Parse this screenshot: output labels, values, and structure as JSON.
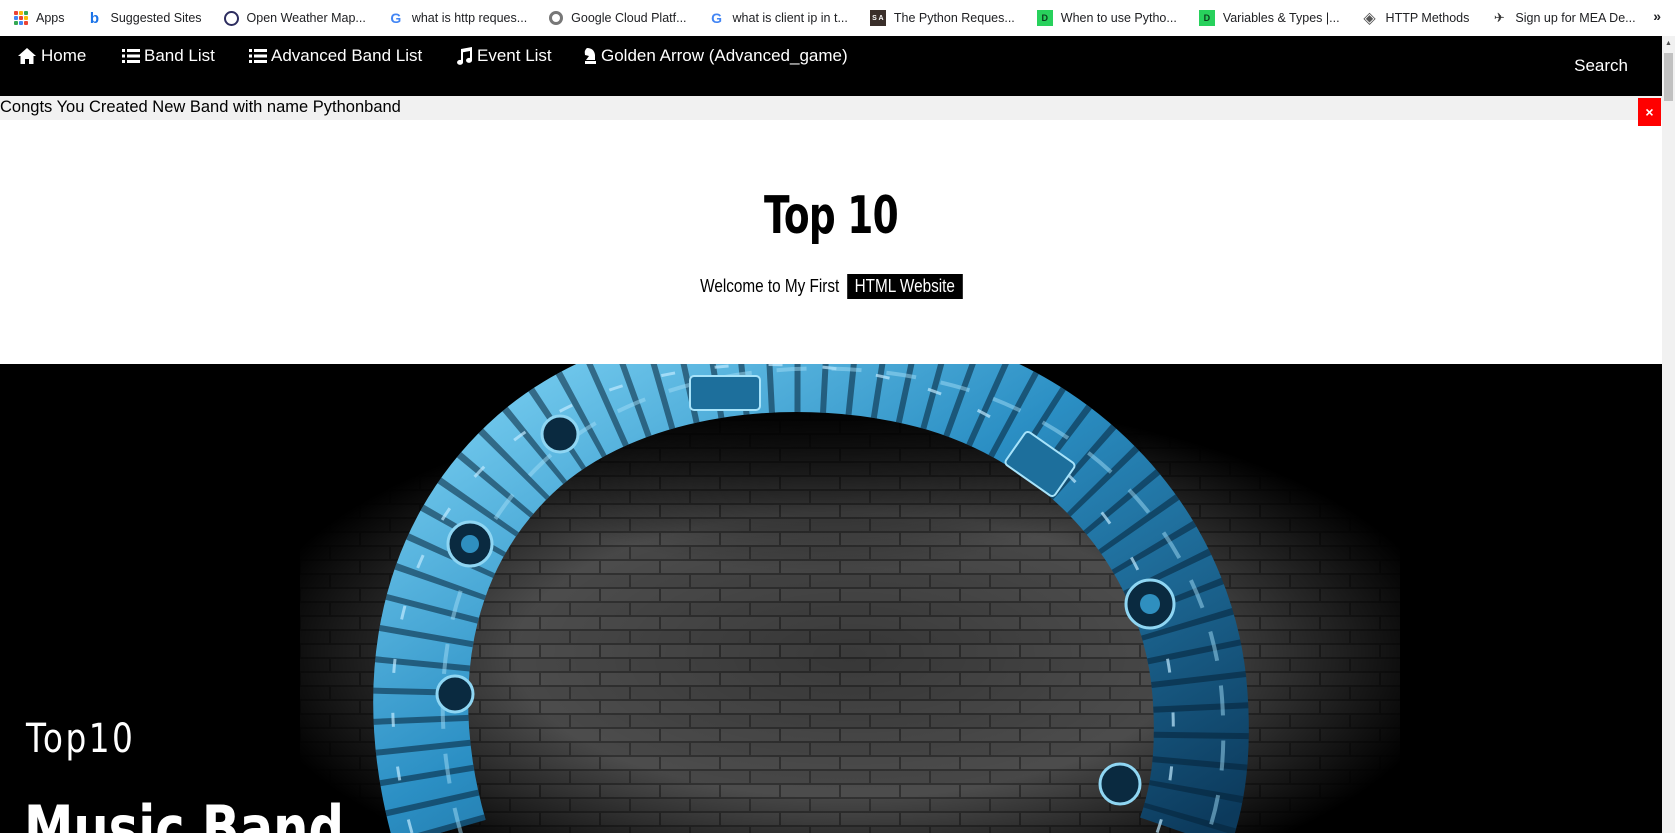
{
  "bookmarks": {
    "items": [
      {
        "label": "Apps",
        "icon": "apps-grid-icon"
      },
      {
        "label": "Suggested Sites",
        "icon": "bing-icon"
      },
      {
        "label": "Open Weather Map...",
        "icon": "openweather-icon"
      },
      {
        "label": "what is http reques...",
        "icon": "google-icon"
      },
      {
        "label": "Google Cloud Platf...",
        "icon": "google-cloud-icon"
      },
      {
        "label": "what is client ip in t...",
        "icon": "google-icon"
      },
      {
        "label": "The Python Reques...",
        "icon": "sa-icon"
      },
      {
        "label": "When to use Pytho...",
        "icon": "datacamp-icon"
      },
      {
        "label": "Variables & Types |...",
        "icon": "datacamp-icon"
      },
      {
        "label": "HTTP Methods",
        "icon": "http-icon"
      },
      {
        "label": "Sign up for MEA De...",
        "icon": "mea-icon"
      }
    ],
    "more": "»"
  },
  "navbar": {
    "items": [
      {
        "label": "Home",
        "icon": "home-icon"
      },
      {
        "label": "Band List",
        "icon": "list-icon"
      },
      {
        "label": "Advanced Band List",
        "icon": "list-icon"
      },
      {
        "label": "Event List",
        "icon": "music-note-icon"
      },
      {
        "label": "Golden Arrow (Advanced_game)",
        "icon": "chess-piece-icon"
      }
    ],
    "search": "Search"
  },
  "alert": {
    "message": "Congts You Created New Band with name Pythonband",
    "close": "×",
    "color": "#ff0000"
  },
  "header": {
    "title": "Top 10",
    "subtitle": "Welcome to My First",
    "tag": "HTML Website"
  },
  "hero": {
    "small_title": "Top10",
    "big_title": "Music Band"
  },
  "colors": {
    "nav_bg": "#000000",
    "alert_bg": "#f1f1f1",
    "accent_blue": "#3aa8d8"
  }
}
